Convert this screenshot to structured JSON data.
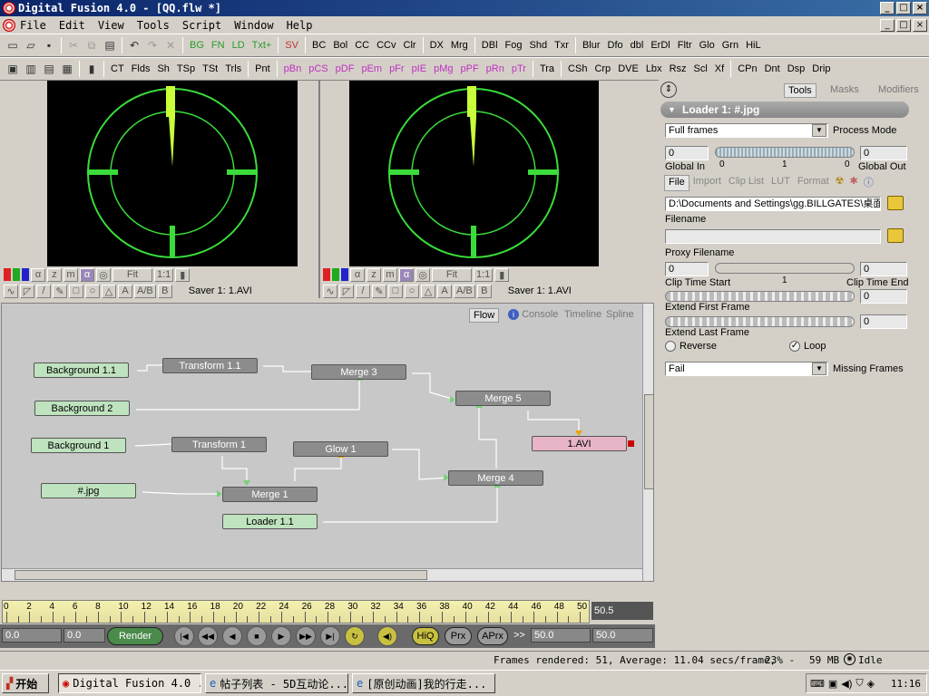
{
  "window": {
    "title": "Digital Fusion 4.0 - [QQ.flw *]"
  },
  "menu": [
    "File",
    "Edit",
    "View",
    "Tools",
    "Script",
    "Window",
    "Help"
  ],
  "toolbar1": [
    "BG",
    "FN",
    "LD",
    "Txt+",
    "SV",
    "BC",
    "Bol",
    "CC",
    "CCv",
    "Clr",
    "DX",
    "Mrg",
    "DBl",
    "Fog",
    "Shd",
    "Txr",
    "Blur",
    "Dfo",
    "dbl",
    "ErDl",
    "Fltr",
    "Glo",
    "Grn",
    "HiL"
  ],
  "toolbar2": [
    "CT",
    "Flds",
    "Sh",
    "TSp",
    "TSt",
    "Trls",
    "Pnt",
    "pBn",
    "pCS",
    "pDF",
    "pEm",
    "pFr",
    "pIE",
    "pMg",
    "pPF",
    "pRn",
    "pTr",
    "Tra",
    "CSh",
    "Crp",
    "DVE",
    "Lbx",
    "Rsz",
    "Scl",
    "Xf",
    "CPn",
    "Dnt",
    "Dsp",
    "Drip"
  ],
  "viewers": [
    {
      "fit": "Fit",
      "ratio": "1:1",
      "label": "Saver 1: 1.AVI"
    },
    {
      "fit": "Fit",
      "ratio": "1:1",
      "label": "Saver 1: 1.AVI"
    }
  ],
  "flow": {
    "tabs": [
      "Flow",
      "Console",
      "Timeline",
      "Spline"
    ],
    "nodes": {
      "bg11": "Background 1.1",
      "tr11": "Transform 1.1",
      "m3": "Merge 3",
      "bg2": "Background 2",
      "m5": "Merge 5",
      "bg1": "Background 1",
      "tr1": "Transform 1",
      "glow": "Glow 1",
      "avi": "1.AVI",
      "jpg": "#.jpg",
      "m1": "Merge 1",
      "m4": "Merge 4",
      "ld11": "Loader 1.1"
    }
  },
  "panel": {
    "tabs": [
      "Tools",
      "Masks",
      "Modifiers"
    ],
    "header": "Loader 1: #.jpg",
    "process_mode_value": "Full frames",
    "process_mode_label": "Process Mode",
    "global_in_value": "0",
    "global_out_value": "0",
    "slider_ticks": [
      "0",
      "1",
      "0"
    ],
    "global_in_label": "Global In",
    "global_out_label": "Global Out",
    "subtabs": [
      "File",
      "Import",
      "Clip List",
      "LUT",
      "Format"
    ],
    "filename_value": "D:\\Documents and Settings\\gg.BILLGATES\\桌面\\",
    "filename_label": "Filename",
    "proxy_value": "",
    "proxy_label": "Proxy Filename",
    "clip_start_value": "0",
    "clip_end_value": "0",
    "clip_mid": "1",
    "clip_start_label": "Clip Time Start",
    "clip_end_label": "Clip Time End",
    "extend_first_value": "0",
    "extend_first_label": "Extend First Frame",
    "extend_last_value": "0",
    "extend_last_label": "Extend Last Frame",
    "reverse_label": "Reverse",
    "loop_label": "Loop",
    "missing_value": "Fail",
    "missing_label": "Missing Frames"
  },
  "timeline": {
    "ticks": [
      "0",
      "2",
      "4",
      "6",
      "8",
      "10",
      "12",
      "14",
      "16",
      "18",
      "20",
      "22",
      "24",
      "26",
      "28",
      "30",
      "32",
      "34",
      "36",
      "38",
      "40",
      "42",
      "44",
      "46",
      "48",
      "50"
    ],
    "end_value": "50.5"
  },
  "transport": {
    "start": "0.0",
    "current": "0.0",
    "render": "Render",
    "hiq": "HiQ",
    "prx": "Prx",
    "aprx": "APrx",
    "arrows": ">>",
    "render_end": "50.0",
    "end": "50.0"
  },
  "status": {
    "frames": "Frames rendered: 51,  Average: 11.04 secs/frame,",
    "zoom": "23% -",
    "mem": "59 MB",
    "state": "Idle"
  },
  "taskbar": {
    "start": "开始",
    "tasks": [
      "Digital Fusion 4.0 ...",
      "帖子列表 - 5D互动论...",
      "[原创动画]我的行走..."
    ],
    "clock": "11:16"
  }
}
